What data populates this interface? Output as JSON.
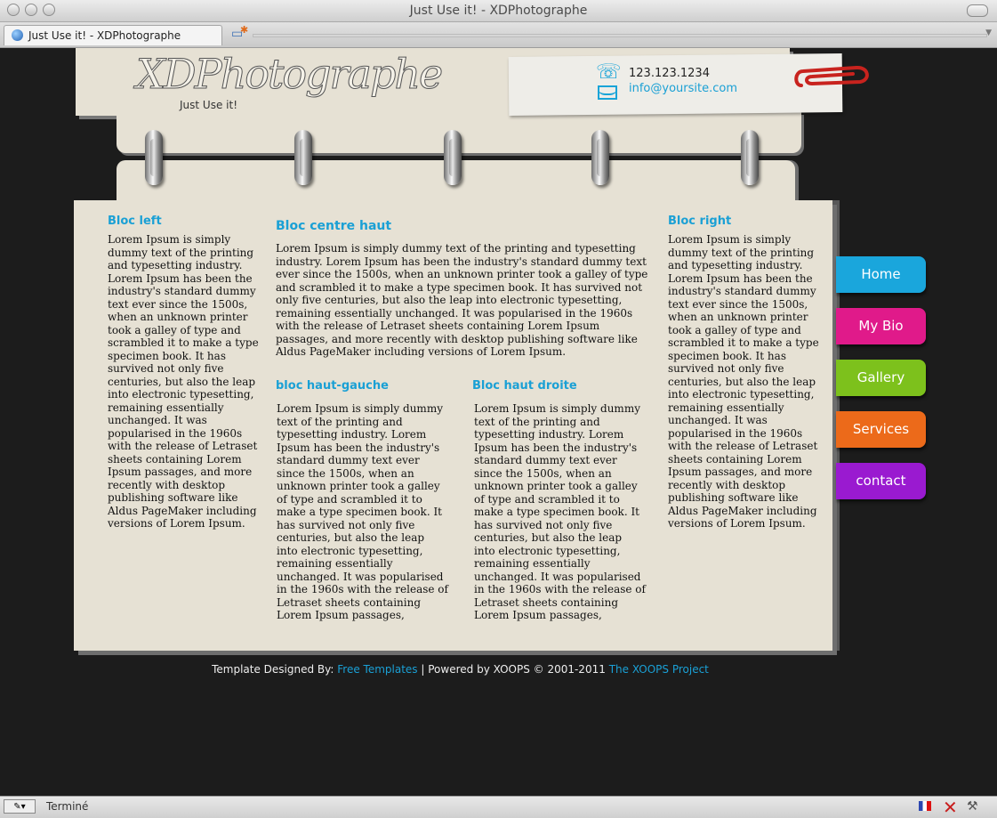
{
  "window": {
    "title": "Just Use it! - XDPhotographe"
  },
  "tab": {
    "label": "Just Use it! - XDPhotographe"
  },
  "header": {
    "logo": "XDPhotographe",
    "slogan": "Just Use it!",
    "phone": "123.123.1234",
    "email": "info@yoursite.com"
  },
  "blocks": {
    "left": {
      "title": "Bloc left",
      "text": "Lorem Ipsum is simply dummy text of the printing and typesetting industry. Lorem Ipsum has been the industry's standard dummy text ever since the 1500s, when an unknown printer took a galley of type and scrambled it to make a type specimen book. It has survived not only five centuries, but also the leap into electronic typesetting, remaining essentially unchanged. It was popularised in the 1960s with the release of Letraset sheets containing Lorem Ipsum passages, and more recently with desktop publishing software like Aldus PageMaker including versions of Lorem Ipsum."
    },
    "center_top": {
      "title": "Bloc centre haut",
      "text": "Lorem Ipsum is simply dummy text of the printing and typesetting industry. Lorem Ipsum has been the industry's standard dummy text ever since the 1500s, when an unknown printer took a galley of type and scrambled it to make a type specimen book. It has survived not only five centuries, but also the leap into electronic typesetting, remaining essentially unchanged. It was popularised in the 1960s with the release of Letraset sheets containing Lorem Ipsum passages, and more recently with desktop publishing software like Aldus PageMaker including versions of Lorem Ipsum."
    },
    "top_left": {
      "title": "bloc haut-gauche",
      "text": "Lorem Ipsum is simply dummy text of the printing and typesetting industry. Lorem Ipsum has been the industry's standard dummy text ever since the 1500s, when an unknown printer took a galley of type and scrambled it to make a type specimen book. It has survived not only five centuries, but also the leap into electronic typesetting, remaining essentially unchanged. It was popularised in the 1960s with the release of Letraset sheets containing Lorem Ipsum passages,"
    },
    "top_right": {
      "title": "Bloc haut droite",
      "text": "Lorem Ipsum is simply dummy text of the printing and typesetting industry. Lorem Ipsum has been the industry's standard dummy text ever since the 1500s, when an unknown printer took a galley of type and scrambled it to make a type specimen book. It has survived not only five centuries, but also the leap into electronic typesetting, remaining essentially unchanged. It was popularised in the 1960s with the release of Letraset sheets containing Lorem Ipsum passages,"
    },
    "right": {
      "title": "Bloc right",
      "text": "Lorem Ipsum is simply dummy text of the printing and typesetting industry. Lorem Ipsum has been the industry's standard dummy text ever since the 1500s, when an unknown printer took a galley of type and scrambled it to make a type specimen book. It has survived not only five centuries, but also the leap into electronic typesetting, remaining essentially unchanged. It was popularised in the 1960s with the release of Letraset sheets containing Lorem Ipsum passages, and more recently with desktop publishing software like Aldus PageMaker including versions of Lorem Ipsum."
    }
  },
  "nav": [
    {
      "label": "Home",
      "color": "#1aa6dc"
    },
    {
      "label": "My Bio",
      "color": "#e01a8a"
    },
    {
      "label": "Gallery",
      "color": "#7dc11c"
    },
    {
      "label": "Services",
      "color": "#ec6a1a"
    },
    {
      "label": "contact",
      "color": "#9a1ad0"
    }
  ],
  "footer": {
    "prefix": "Template Designed By:",
    "link1": "Free Templates",
    "middle": "| Powered by XOOPS © 2001-2011",
    "link2": "The XOOPS Project"
  },
  "status": {
    "text": "Terminé"
  },
  "colors": {
    "accent": "#1aa0d5",
    "paper": "#e6e1d4",
    "background": "#1c1c1c"
  }
}
